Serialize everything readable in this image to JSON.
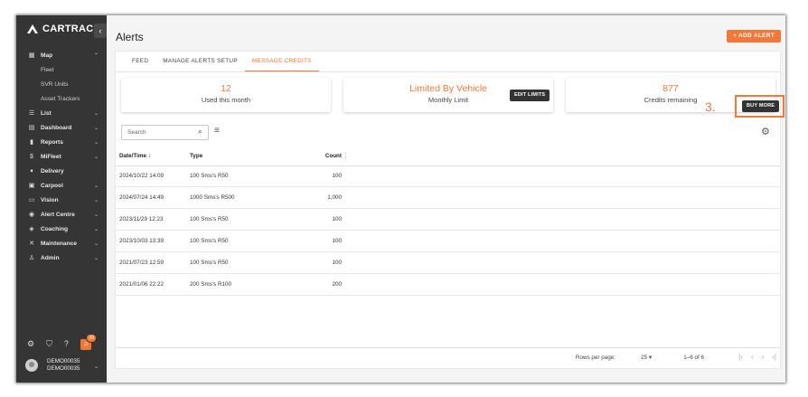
{
  "sidebar": {
    "brand": "CARTRACK",
    "menu": [
      {
        "label": "Map",
        "icon": "map-icon",
        "chevron": "up"
      },
      {
        "label": "Fleet",
        "sub": true
      },
      {
        "label": "SVR Units",
        "sub": true
      },
      {
        "label": "Asset Trackers",
        "sub": true
      },
      {
        "label": "List",
        "icon": "list-icon",
        "chevron": "down"
      },
      {
        "label": "Dashboard",
        "icon": "dashboard-icon",
        "chevron": "down"
      },
      {
        "label": "Reports",
        "icon": "reports-icon",
        "chevron": "down"
      },
      {
        "label": "MiFleet",
        "icon": "dollar-icon",
        "chevron": "down"
      },
      {
        "label": "Delivery",
        "icon": "delivery-icon",
        "chevron": ""
      },
      {
        "label": "Carpool",
        "icon": "calendar-icon",
        "chevron": "down"
      },
      {
        "label": "Vision",
        "icon": "vision-icon",
        "chevron": "down"
      },
      {
        "label": "Alert Centre",
        "icon": "alert-icon",
        "chevron": "down"
      },
      {
        "label": "Coaching",
        "icon": "coaching-icon",
        "chevron": "down"
      },
      {
        "label": "Maintenance",
        "icon": "tools-icon",
        "chevron": "down"
      },
      {
        "label": "Admin",
        "icon": "admin-icon",
        "chevron": "down"
      }
    ],
    "notification_count": "30",
    "user": {
      "name": "DEMO00035",
      "account": "DEMO00035"
    }
  },
  "header": {
    "title": "Alerts",
    "add_alert": "+ ADD ALERT"
  },
  "tabs": [
    "FEED",
    "MANAGE ALERTS SETUP",
    "MESSAGE CREDITS"
  ],
  "active_tab": "MESSAGE CREDITS",
  "cards": {
    "used": {
      "value": "12",
      "label": "Used this month"
    },
    "limit": {
      "value": "Limited By Vehicle",
      "label": "Monthly Limit",
      "button": "EDIT LIMITS"
    },
    "credits": {
      "value": "877",
      "label": "Credits remaining",
      "button": "BUY MORE"
    }
  },
  "annotation_step": "3.",
  "search": {
    "placeholder": "Search"
  },
  "table": {
    "columns": [
      "Date/Time ↓",
      "Type",
      "Count"
    ],
    "rows": [
      {
        "datetime": "2024/10/22 14:09",
        "type": "100 Sms's R50",
        "count": "100"
      },
      {
        "datetime": "2024/07/24 14:49",
        "type": "1000 Sms's R500",
        "count": "1,000"
      },
      {
        "datetime": "2023/11/29 12:23",
        "type": "100 Sms's R50",
        "count": "100"
      },
      {
        "datetime": "2023/10/03 13:39",
        "type": "100 Sms's R50",
        "count": "100"
      },
      {
        "datetime": "2021/07/23 12:59",
        "type": "100 Sms's R50",
        "count": "100"
      },
      {
        "datetime": "2021/01/06 22:22",
        "type": "200 Sms's R100",
        "count": "200"
      }
    ]
  },
  "pagination": {
    "rows_per_page_label": "Rows per page:",
    "rows_per_page": "25",
    "range": "1–6 of 6"
  },
  "colors": {
    "accent": "#f47735",
    "sidebar": "#353535"
  }
}
